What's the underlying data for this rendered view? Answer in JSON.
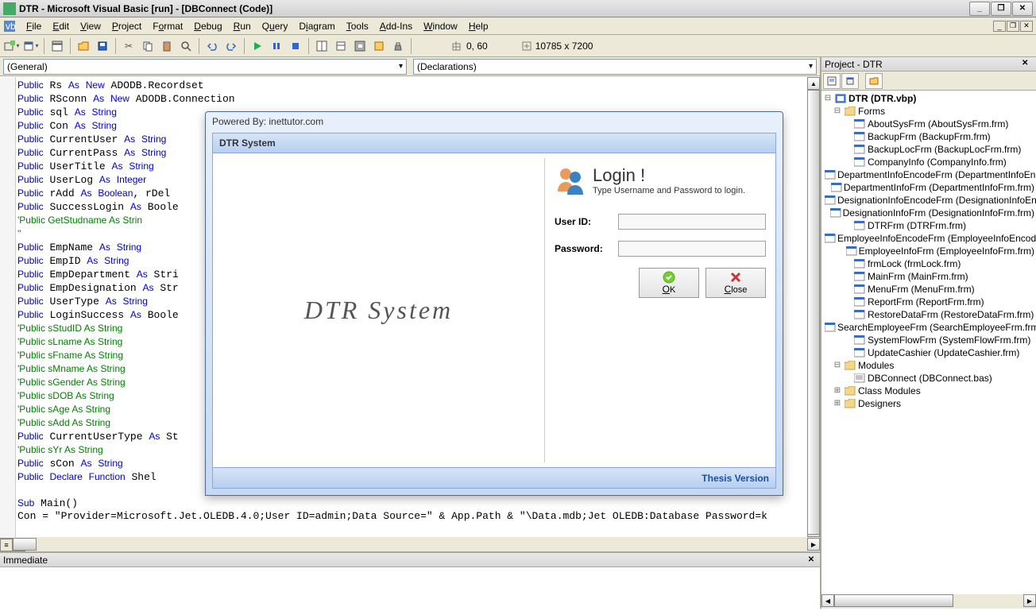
{
  "window": {
    "title": "DTR - Microsoft Visual Basic [run] - [DBConnect (Code)]"
  },
  "menu": [
    "File",
    "Edit",
    "View",
    "Project",
    "Format",
    "Debug",
    "Run",
    "Query",
    "Diagram",
    "Tools",
    "Add-Ins",
    "Window",
    "Help"
  ],
  "status": {
    "pos": "0, 60",
    "dim": "10785 x 7200"
  },
  "combos": {
    "left": "(General)",
    "right": "(Declarations)"
  },
  "immediate": {
    "title": "Immediate"
  },
  "project": {
    "title": "Project - DTR",
    "root": "DTR (DTR.vbp)",
    "forms_label": "Forms",
    "forms": [
      "AboutSysFrm (AboutSysFrm.frm)",
      "BackupFrm (BackupFrm.frm)",
      "BackupLocFrm (BackupLocFrm.frm)",
      "CompanyInfo (CompanyInfo.frm)",
      "DepartmentInfoEncodeFrm (DepartmentInfoEncodeFrm.frm)",
      "DepartmentInfoFrm (DepartmentInfoFrm.frm)",
      "DesignationInfoEncodeFrm (DesignationInfoEncodeFrm.frm)",
      "DesignationInfoFrm (DesignationInfoFrm.frm)",
      "DTRFrm (DTRFrm.frm)",
      "EmployeeInfoEncodeFrm (EmployeeInfoEncodeFrm.frm)",
      "EmployeeInfoFrm (EmployeeInfoFrm.frm)",
      "frmLock (frmLock.frm)",
      "MainFrm (MainFrm.frm)",
      "MenuFrm (MenuFrm.frm)",
      "ReportFrm (ReportFrm.frm)",
      "RestoreDataFrm (RestoreDataFrm.frm)",
      "SearchEmployeeFrm (SearchEmployeeFrm.frm)",
      "SystemFlowFrm (SystemFlowFrm.frm)",
      "UpdateCashier (UpdateCashier.frm)"
    ],
    "modules_label": "Modules",
    "modules": [
      "DBConnect (DBConnect.bas)"
    ],
    "classmod_label": "Class Modules",
    "designers_label": "Designers"
  },
  "dialog": {
    "powered": "Powered By: inettutor.com",
    "header": "DTR System",
    "brand": "DTR  System",
    "login_title": "Login !",
    "login_sub": "Type Username and Password to login.",
    "userid_label": "User ID:",
    "password_label": "Password:",
    "ok": "OK",
    "close": "Close",
    "footer": "Thesis Version"
  },
  "code": [
    {
      "t": "Public Rs As New ADODB.Recordset",
      "c": 0
    },
    {
      "t": "Public RSconn As New ADODB.Connection",
      "c": 0
    },
    {
      "t": "Public sql As String",
      "c": 0
    },
    {
      "t": "Public Con As String",
      "c": 0
    },
    {
      "t": "Public CurrentUser As String",
      "c": 0
    },
    {
      "t": "Public CurrentPass As String",
      "c": 0
    },
    {
      "t": "Public UserTitle As String",
      "c": 0
    },
    {
      "t": "Public UserLog As Integer",
      "c": 0
    },
    {
      "t": "Public rAdd As Boolean, rDel",
      "c": 0
    },
    {
      "t": "Public SuccessLogin As Boole",
      "c": 0
    },
    {
      "t": "'Public GetStudname As Strin",
      "c": 1
    },
    {
      "t": "''",
      "c": 1
    },
    {
      "t": "Public EmpName As String",
      "c": 0
    },
    {
      "t": "Public EmpID As String",
      "c": 0
    },
    {
      "t": "Public EmpDepartment As Stri",
      "c": 0
    },
    {
      "t": "Public EmpDesignation As Str",
      "c": 0
    },
    {
      "t": "Public UserType As String",
      "c": 0
    },
    {
      "t": "Public LoginSuccess As Boole",
      "c": 0
    },
    {
      "t": "'Public sStudID As String",
      "c": 1
    },
    {
      "t": "'Public sLname As String",
      "c": 1
    },
    {
      "t": "'Public sFname As String",
      "c": 1
    },
    {
      "t": "'Public sMname As String",
      "c": 1
    },
    {
      "t": "'Public sGender As String",
      "c": 1
    },
    {
      "t": "'Public sDOB As String",
      "c": 1
    },
    {
      "t": "'Public sAge As String",
      "c": 1
    },
    {
      "t": "'Public sAdd As String",
      "c": 1
    },
    {
      "t": "Public CurrentUserType As St",
      "c": 0
    },
    {
      "t": "'Public sYr As String",
      "c": 1
    },
    {
      "t": "Public sCon As String",
      "c": 0
    },
    {
      "t": "Public Declare Function Shel",
      "c": 0
    },
    {
      "t": "",
      "c": 0
    },
    {
      "t": "Sub Main()",
      "c": 0
    },
    {
      "t": "Con = \"Provider=Microsoft.Jet.OLEDB.4.0;User ID=admin;Data Source=\" & App.Path & \"\\Data.mdb;Jet OLEDB:Database Password=k",
      "c": 0
    }
  ]
}
